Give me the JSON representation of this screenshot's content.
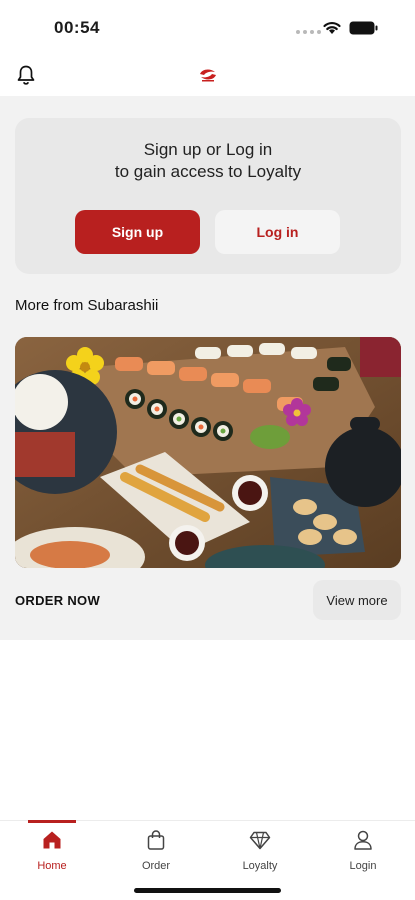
{
  "status_bar": {
    "time": "00:54"
  },
  "header": {
    "bell_icon": "bell-icon",
    "logo_icon": "subarashii-logo"
  },
  "loyalty": {
    "line1": "Sign up or Log in",
    "line2": "to gain access to Loyalty",
    "signup_label": "Sign up",
    "login_label": "Log in"
  },
  "more": {
    "title": "More from Subarashii",
    "image_alt": "sushi platter",
    "order_now": "ORDER NOW",
    "view_more": "View more"
  },
  "tabs": [
    {
      "label": "Home",
      "icon": "home-icon",
      "active": true
    },
    {
      "label": "Order",
      "icon": "bag-icon",
      "active": false
    },
    {
      "label": "Loyalty",
      "icon": "diamond-icon",
      "active": false
    },
    {
      "label": "Login",
      "icon": "user-icon",
      "active": false
    }
  ],
  "colors": {
    "accent": "#b8201f",
    "card_bg": "#e8e8e8",
    "page_bg": "#f2f2f2"
  }
}
